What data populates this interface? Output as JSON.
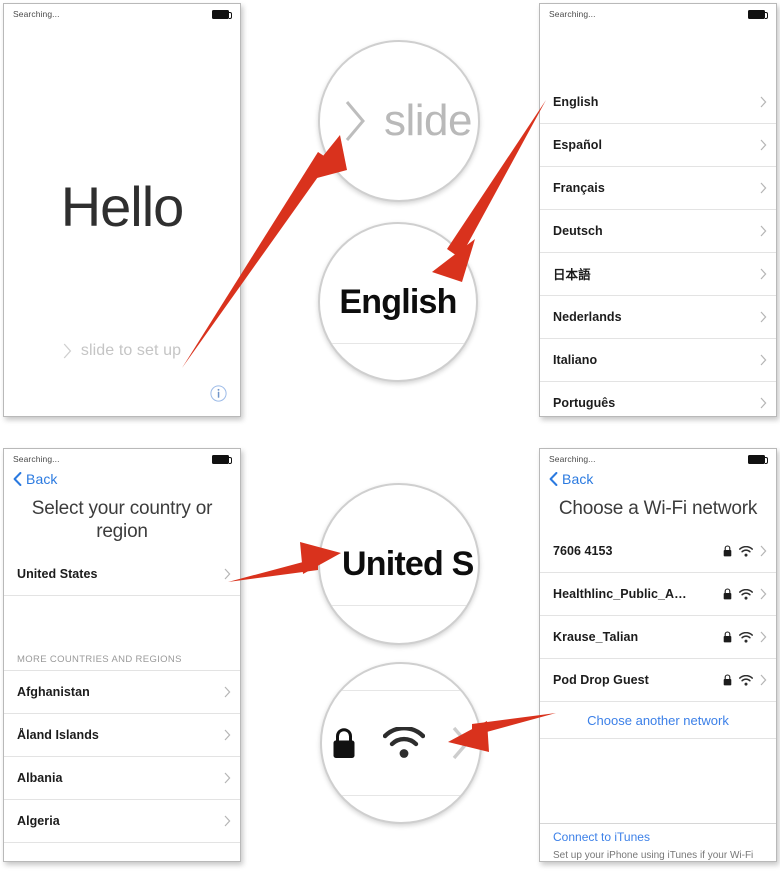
{
  "status_bar": {
    "carrier_text": "Searching...",
    "battery_icon": "battery-icon"
  },
  "panels": {
    "hello": {
      "name": "hello-screen",
      "headline": "Hello",
      "slide_label": "slide to set up",
      "slide_chevron_icon": "chevron-right-icon",
      "info_icon": "info-circle-icon"
    },
    "language": {
      "name": "language-screen",
      "items": [
        {
          "label": "English",
          "chevron_icon": "chevron-right-icon"
        },
        {
          "label": "Español",
          "chevron_icon": "chevron-right-icon"
        },
        {
          "label": "Français",
          "chevron_icon": "chevron-right-icon"
        },
        {
          "label": "Deutsch",
          "chevron_icon": "chevron-right-icon"
        },
        {
          "label": "日本語",
          "chevron_icon": "chevron-right-icon"
        },
        {
          "label": "Nederlands",
          "chevron_icon": "chevron-right-icon"
        },
        {
          "label": "Italiano",
          "chevron_icon": "chevron-right-icon"
        },
        {
          "label": "Português",
          "chevron_icon": "chevron-right-icon"
        }
      ]
    },
    "country": {
      "name": "country-screen",
      "back_label": "Back",
      "back_icon": "chevron-left-icon",
      "title": "Select your country or region",
      "selected": {
        "label": "United States",
        "chevron_icon": "chevron-right-icon"
      },
      "section_header": "MORE COUNTRIES AND REGIONS",
      "items": [
        {
          "label": "Afghanistan",
          "chevron_icon": "chevron-right-icon"
        },
        {
          "label": "Åland Islands",
          "chevron_icon": "chevron-right-icon"
        },
        {
          "label": "Albania",
          "chevron_icon": "chevron-right-icon"
        },
        {
          "label": "Algeria",
          "chevron_icon": "chevron-right-icon"
        }
      ]
    },
    "wifi": {
      "name": "wifi-screen",
      "back_label": "Back",
      "back_icon": "chevron-left-icon",
      "title": "Choose a Wi-Fi network",
      "networks": [
        {
          "ssid": "7606 4153",
          "lock_icon": "lock-icon",
          "wifi_icon": "wifi-icon",
          "chevron_icon": "chevron-right-icon"
        },
        {
          "ssid": "Healthlinc_Public_A…",
          "lock_icon": "lock-icon",
          "wifi_icon": "wifi-icon",
          "chevron_icon": "chevron-right-icon"
        },
        {
          "ssid": "Krause_Talian",
          "lock_icon": "lock-icon",
          "wifi_icon": "wifi-icon",
          "chevron_icon": "chevron-right-icon"
        },
        {
          "ssid": "Pod Drop Guest",
          "lock_icon": "lock-icon",
          "wifi_icon": "wifi-icon",
          "chevron_icon": "chevron-right-icon"
        }
      ],
      "choose_another": "Choose another network",
      "itunes_link": "Connect to iTunes",
      "itunes_note": "Set up your iPhone using iTunes if your Wi-Fi"
    }
  },
  "magnifiers": [
    {
      "name": "magnifier-slide",
      "text": "slide",
      "chevron_icon": "chevron-right-icon"
    },
    {
      "name": "magnifier-english",
      "text": "English"
    },
    {
      "name": "magnifier-country",
      "text": "United S"
    },
    {
      "name": "magnifier-wifi-icons",
      "lock_icon": "lock-icon",
      "wifi_icon": "wifi-icon",
      "chevron_icon": "chevron-right-icon"
    }
  ],
  "annotation": {
    "arrow_color": "#d9321d",
    "arrow_count": 4
  }
}
